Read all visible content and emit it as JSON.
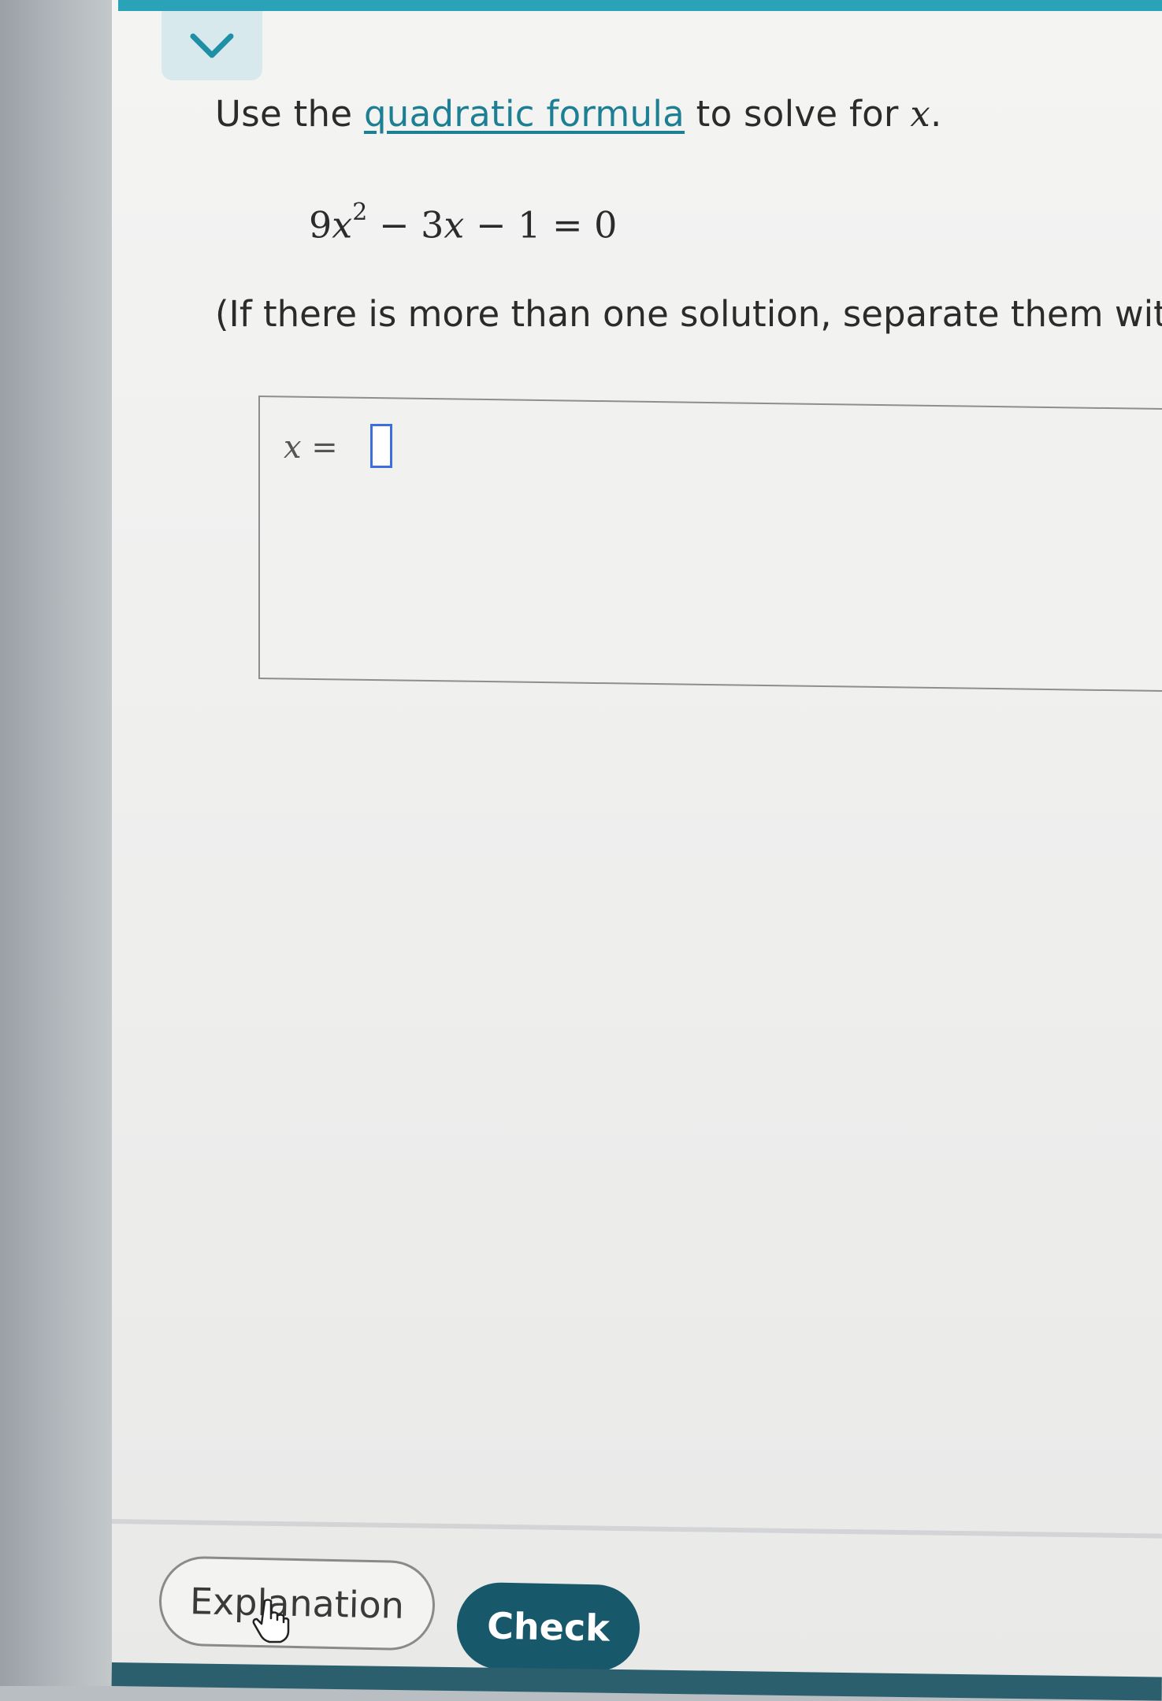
{
  "question": {
    "prompt_before_link": "Use the ",
    "link_text": "quadratic formula",
    "prompt_after_link": " to solve for ",
    "prompt_variable": "x",
    "prompt_period": ".",
    "equation": {
      "coef_a": "9",
      "var": "x",
      "exponent": "2",
      "middle": " − 3",
      "var2": "x",
      "rest": " − 1 = 0"
    },
    "instruction": "(If there is more than one solution, separate them wit"
  },
  "answer": {
    "label_var": "x",
    "label_equals": " =",
    "value": ""
  },
  "buttons": {
    "explanation_label": "Explanation",
    "check_label": "Check"
  },
  "colors": {
    "accent": "#2aa3b8",
    "link": "#1d7f93",
    "check_button": "#17586a",
    "input_border": "#3d6ee0"
  },
  "icons": {
    "collapse": "chevron-down-icon",
    "cursor": "hand-cursor-icon"
  }
}
